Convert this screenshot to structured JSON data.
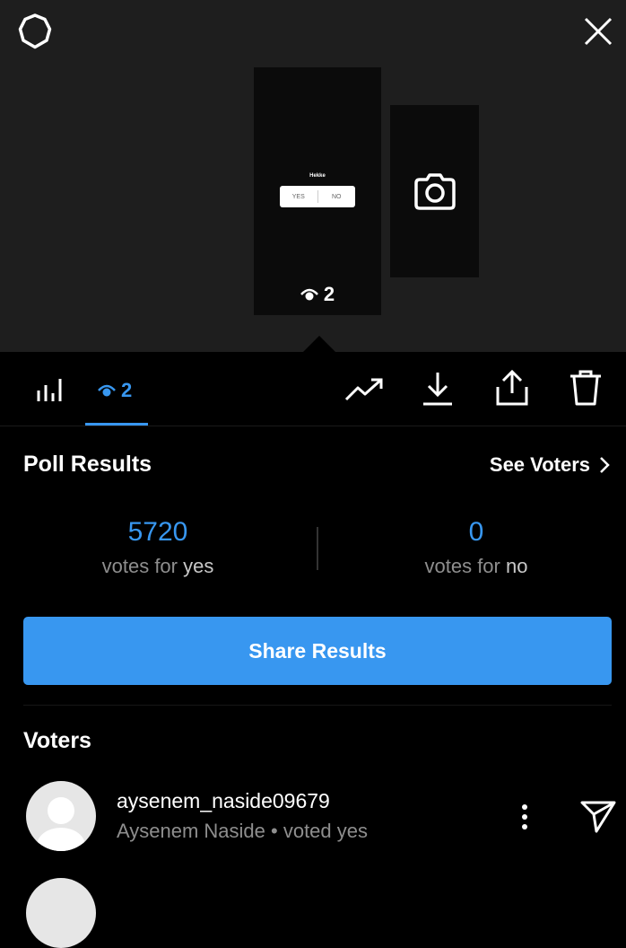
{
  "top": {
    "story_main": {
      "poll_question": "Hekke",
      "poll_option_yes": "YES",
      "poll_option_no": "NO",
      "view_count": "2"
    }
  },
  "toolbar": {
    "views_tab_count": "2"
  },
  "poll_results": {
    "title": "Poll Results",
    "see_voters_label": "See Voters",
    "yes_count": "5720",
    "yes_label_prefix": "votes for",
    "yes_label_choice": "yes",
    "no_count": "0",
    "no_label_prefix": "votes for",
    "no_label_choice": "no",
    "share_button_label": "Share Results"
  },
  "voters": {
    "title": "Voters",
    "items": [
      {
        "username": "aysenem_naside09679",
        "subtitle": "Aysenem Naside • voted yes"
      }
    ]
  },
  "colors": {
    "accent": "#3897f0",
    "top_background": "#1e1e1e",
    "background": "#000000",
    "muted_text": "#8e8e8e"
  },
  "icons": [
    "settings-icon",
    "close-icon",
    "camera-icon",
    "eye-icon",
    "bar-chart-icon",
    "trending-icon",
    "download-icon",
    "share-icon",
    "trash-icon",
    "chevron-right-icon",
    "more-icon",
    "send-icon"
  ]
}
